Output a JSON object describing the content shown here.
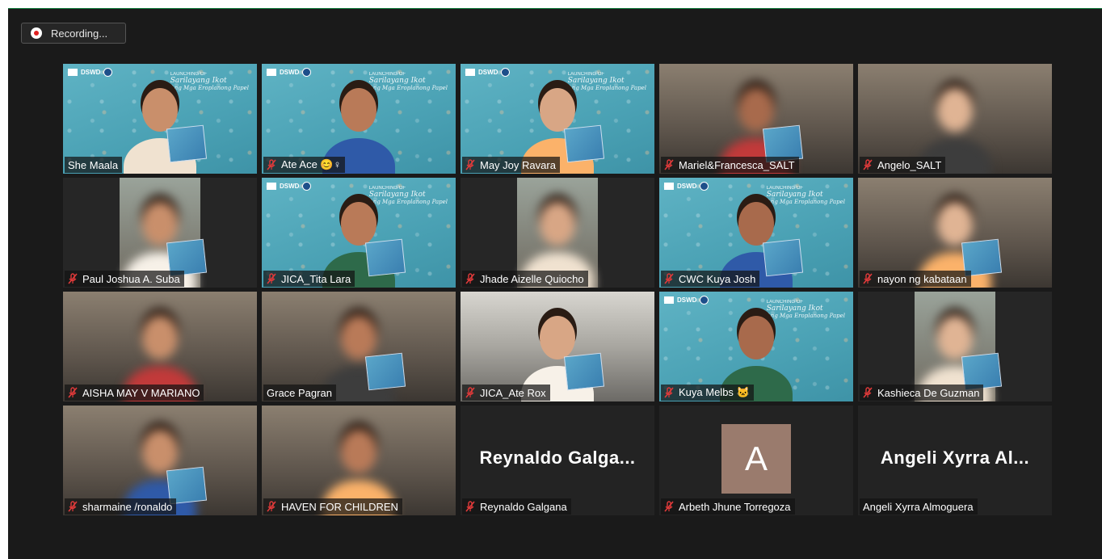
{
  "recording": {
    "label": "Recording..."
  },
  "banner": {
    "org": "DSWD",
    "text_line1": "LAUNCHING OF",
    "text_line2": "Sarilayang Ikot",
    "text_line3": "Ang Mga Eroplanong Papel"
  },
  "participants": [
    {
      "name": "She Maala",
      "muted": false,
      "active": true,
      "bg": "teal"
    },
    {
      "name": "Ate Ace 😊♀",
      "muted": true,
      "active": false,
      "bg": "teal"
    },
    {
      "name": "May Joy Ravara",
      "muted": true,
      "active": false,
      "bg": "teal"
    },
    {
      "name": "Mariel&Francesca_SALT",
      "muted": true,
      "active": false,
      "bg": "room"
    },
    {
      "name": "Angelo_SALT",
      "muted": true,
      "active": false,
      "bg": "room"
    },
    {
      "name": "Paul Joshua A. Suba",
      "muted": true,
      "active": false,
      "bg": "dark"
    },
    {
      "name": "JICA_Tita Lara",
      "muted": true,
      "active": false,
      "bg": "teal"
    },
    {
      "name": "Jhade Aizelle Quiocho",
      "muted": true,
      "active": false,
      "bg": "dark"
    },
    {
      "name": "CWC Kuya Josh",
      "muted": true,
      "active": false,
      "bg": "teal"
    },
    {
      "name": "nayon ng kabataan",
      "muted": true,
      "active": false,
      "bg": "room"
    },
    {
      "name": "AISHA MAY V MARIANO",
      "muted": true,
      "active": false,
      "bg": "room"
    },
    {
      "name": "Grace Pagran",
      "muted": false,
      "active": false,
      "bg": "room"
    },
    {
      "name": "JICA_Ate Rox",
      "muted": true,
      "active": false,
      "bg": "office"
    },
    {
      "name": "Kuya Melbs 🐱",
      "muted": true,
      "active": false,
      "bg": "teal"
    },
    {
      "name": "Kashieca De Guzman",
      "muted": true,
      "active": false,
      "bg": "dark"
    },
    {
      "name": "sharmaine /ronaldo",
      "muted": true,
      "active": false,
      "bg": "room"
    },
    {
      "name": "HAVEN FOR CHILDREN",
      "muted": true,
      "active": false,
      "bg": "room"
    },
    {
      "name": "Reynaldo Galgana",
      "muted": true,
      "active": false,
      "bg": "none",
      "display": "Reynaldo  Galga..."
    },
    {
      "name": "Arbeth Jhune Torregoza",
      "muted": true,
      "active": false,
      "bg": "none",
      "avatar": "A"
    },
    {
      "name": "Angeli Xyrra Almoguera",
      "muted": false,
      "active": false,
      "bg": "none",
      "display": "Angeli  Xyrra  Al..."
    }
  ],
  "colors": {
    "active_border": "#d9e86a",
    "muted_icon": "#e03a3a",
    "avatar_bg": "#9a7b6d",
    "banner_teal": "#4aa1b4"
  }
}
